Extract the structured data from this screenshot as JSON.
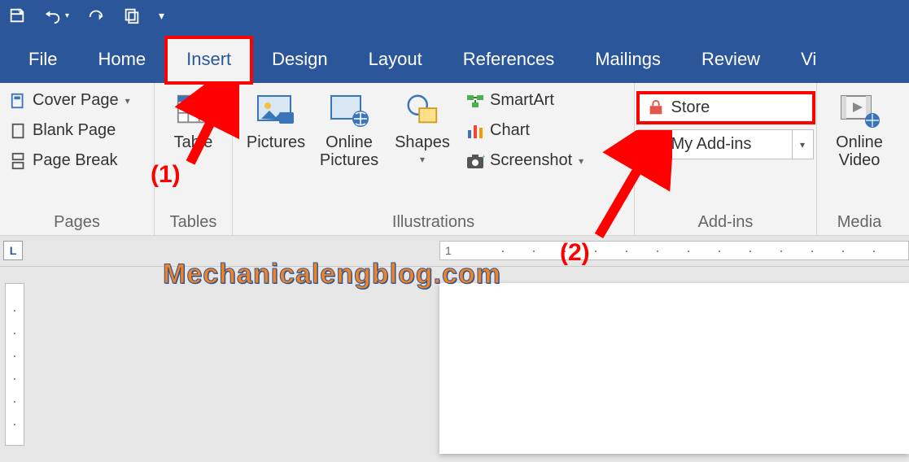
{
  "qat": {
    "save": "save-icon",
    "undo": "undo-icon",
    "redo": "redo-icon",
    "copy": "copy-icon",
    "customize": "customize-icon"
  },
  "tabs": {
    "file": "File",
    "home": "Home",
    "insert": "Insert",
    "design": "Design",
    "layout": "Layout",
    "references": "References",
    "mailings": "Mailings",
    "review": "Review",
    "view_partial": "Vi"
  },
  "groups": {
    "pages": {
      "label": "Pages",
      "cover_page": "Cover Page",
      "blank_page": "Blank Page",
      "page_break": "Page Break"
    },
    "tables": {
      "label": "Tables",
      "table": "Table"
    },
    "illustrations": {
      "label": "Illustrations",
      "pictures": "Pictures",
      "online_pictures": "Online\nPictures",
      "shapes": "Shapes",
      "smartart": "SmartArt",
      "chart": "Chart",
      "screenshot": "Screenshot"
    },
    "addins": {
      "label": "Add-ins",
      "store": "Store",
      "my_addins": "My Add-ins"
    },
    "media": {
      "label": "Media",
      "online_video": "Online\nVideo"
    }
  },
  "ruler": {
    "mark1": "1"
  },
  "annotations": {
    "one": "(1)",
    "two": "(2)",
    "watermark": "Mechanicalengblog.com"
  }
}
